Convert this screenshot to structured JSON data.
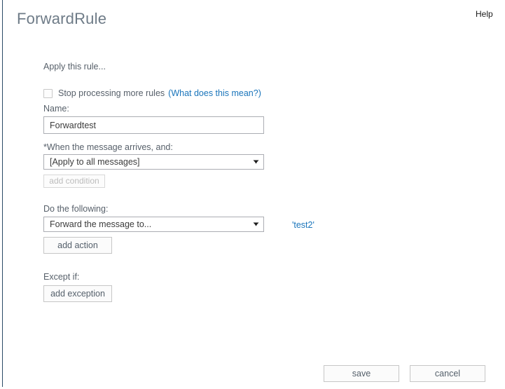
{
  "header": {
    "title": "ForwardRule",
    "help_label": "Help"
  },
  "form": {
    "apply_rule_label": "Apply this rule...",
    "stop_processing": {
      "checked": false,
      "label": "Stop processing more rules",
      "help_link": "(What does this mean?)"
    },
    "name": {
      "label": "Name:",
      "value": "Forwardtest",
      "placeholder": ""
    },
    "condition": {
      "label": "*When the message arrives, and:",
      "selected": "[Apply to all messages]",
      "arrow_icon": "chevron-down-icon",
      "add_button_label": "add condition",
      "add_button_enabled": false
    },
    "action": {
      "label": "Do the following:",
      "selected": "Forward the message to...",
      "arrow_icon": "chevron-down-icon",
      "target_link": "'test2'",
      "add_button_label": "add action",
      "add_button_enabled": true
    },
    "exception": {
      "label": "Except if:",
      "add_button_label": "add exception"
    }
  },
  "footer": {
    "save_label": "save",
    "cancel_label": "cancel"
  },
  "colors": {
    "link": "#1a75bb",
    "title": "#6e7b87",
    "text": "#57606a",
    "border": "#abadb3",
    "frame_edge": "#2b4b66"
  }
}
